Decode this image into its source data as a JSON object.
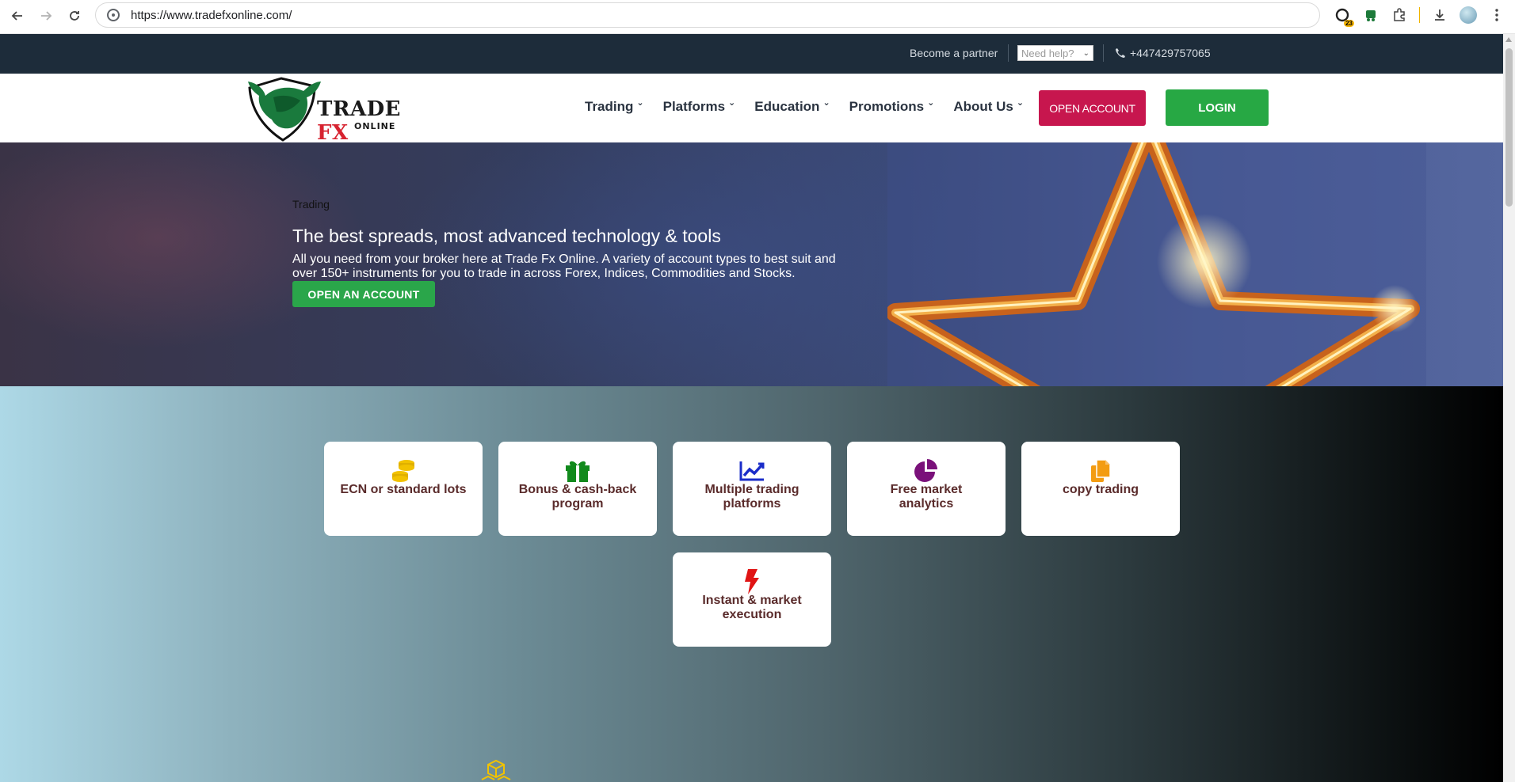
{
  "browser": {
    "url": "https://www.tradefxonline.com/",
    "ext_badge": "23"
  },
  "topbar": {
    "partner": "Become a partner",
    "help": "Need help?",
    "phone": "+447429757065"
  },
  "header": {
    "logo_main": "TRADE",
    "logo_fx": "FX",
    "logo_sub": "ONLINE",
    "menu": [
      {
        "label": "Trading"
      },
      {
        "label": "Platforms"
      },
      {
        "label": "Education"
      },
      {
        "label": "Promotions"
      },
      {
        "label": "About Us"
      }
    ],
    "open_account": "OPEN ACCOUNT",
    "login": "LOGIN"
  },
  "hero": {
    "crumb": "Trading",
    "title": "The best spreads, most advanced technology & tools",
    "text": "All you need from your broker here at Trade Fx Online. A variety of account types to best suit and over 150+ instruments for you to trade in across Forex, Indices, Commodities and Stocks.",
    "cta": "OPEN AN ACCOUNT"
  },
  "features": [
    {
      "label": "ECN or standard lots",
      "icon": "coins-icon",
      "color": "#f2c200"
    },
    {
      "label": "Bonus & cash-back program",
      "icon": "gift-icon",
      "color": "#118a1c"
    },
    {
      "label": "Multiple trading platforms",
      "icon": "chart-line-icon",
      "color": "#1a2cc9"
    },
    {
      "label": "Free market analytics",
      "icon": "pie-chart-icon",
      "color": "#7a117a"
    },
    {
      "label": "copy trading",
      "icon": "copy-icon",
      "color": "#f39c12"
    },
    {
      "label": "Instant & market execution",
      "icon": "bolt-icon",
      "color": "#e01414"
    }
  ],
  "colors": {
    "topbar": "#1d2c3a",
    "open_account": "#c7164e",
    "login": "#27a844",
    "cta": "#2aa64a",
    "card_text": "#5a2b2b"
  }
}
